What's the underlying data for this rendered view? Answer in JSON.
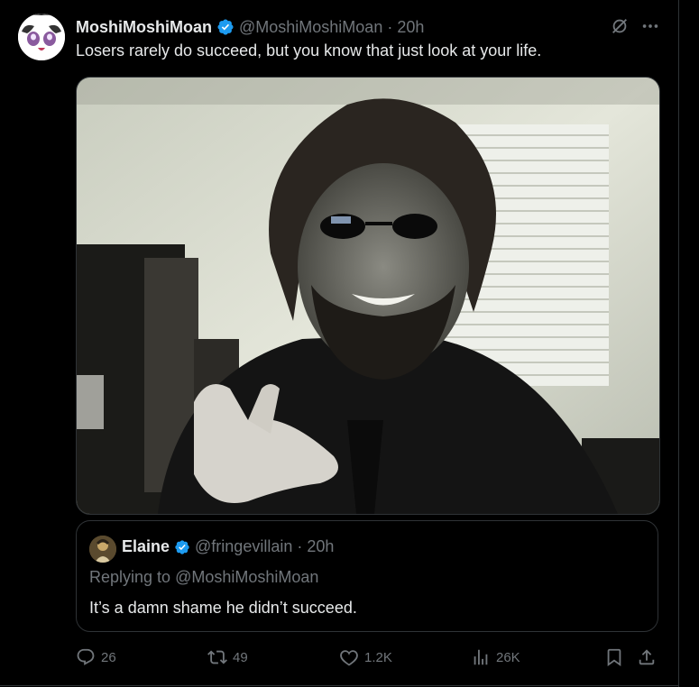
{
  "tweet": {
    "author_name": "MoshiMoshiMoan",
    "author_handle": "@MoshiMoshiMoan",
    "separator": "·",
    "time": "20h",
    "text": "Losers rarely do succeed, but you know that just look at your life.",
    "icons": [
      "grok-icon",
      "more-icon"
    ]
  },
  "quote": {
    "author_name": "Elaine",
    "author_handle": "@fringevillain",
    "separator": "·",
    "time": "20h",
    "replying_prefix": "Replying to ",
    "replying_to": "@MoshiMoshiMoan",
    "text": "It’s a damn shame he didn’t succeed."
  },
  "actions": {
    "replies": "26",
    "reposts": "49",
    "likes": "1.2K",
    "views": "26K"
  },
  "colors": {
    "accent": "#1d9bf0",
    "muted": "#71767b",
    "text": "#e7e9ea",
    "border": "#2f3336",
    "background": "#000000"
  }
}
